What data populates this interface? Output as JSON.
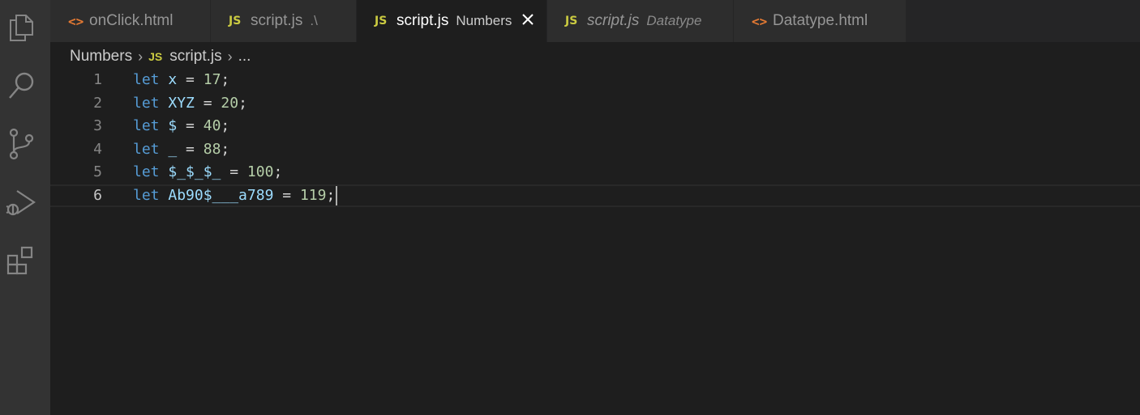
{
  "activity_bar": {
    "icons": [
      "files-icon",
      "search-icon",
      "source-control-icon",
      "run-debug-icon",
      "extensions-icon"
    ]
  },
  "tabs": [
    {
      "name": "onClick.html",
      "desc": "",
      "type": "html"
    },
    {
      "name": "script.js",
      "desc": ".\\",
      "type": "js"
    },
    {
      "name": "script.js",
      "desc": "Numbers",
      "type": "js",
      "active": true
    },
    {
      "name": "script.js",
      "desc": "Datatype",
      "type": "js",
      "italic": true
    },
    {
      "name": "Datatype.html",
      "desc": "",
      "type": "html"
    }
  ],
  "tab_icons": {
    "html": "<>",
    "js": "JS"
  },
  "breadcrumb": {
    "folder": "Numbers",
    "file_icon": "JS",
    "file": "script.js",
    "ellipsis": "..."
  },
  "editor": {
    "lines": [
      {
        "number": "1",
        "keyword": "let",
        "var": "x",
        "op": "=",
        "value": "17",
        "end": ";"
      },
      {
        "number": "2",
        "keyword": "let",
        "var": "XYZ",
        "op": "=",
        "value": "20",
        "end": ";"
      },
      {
        "number": "3",
        "keyword": "let",
        "var": "$",
        "op": "=",
        "value": "40",
        "end": ";"
      },
      {
        "number": "4",
        "keyword": "let",
        "var": "_",
        "op": "=",
        "value": "88",
        "end": ";"
      },
      {
        "number": "5",
        "keyword": "let",
        "var": "$_$_$_",
        "op": "=",
        "value": "100",
        "end": ";"
      },
      {
        "number": "6",
        "keyword": "let",
        "var": "Ab90$___a789",
        "op": "=",
        "value": "119",
        "end": ";"
      }
    ],
    "current_line": 6
  },
  "colors": {
    "keyword": "#569cd6",
    "variable": "#9cdcfe",
    "number": "#b5cea8",
    "html_icon": "#e37933",
    "js_icon": "#cbcb41"
  }
}
